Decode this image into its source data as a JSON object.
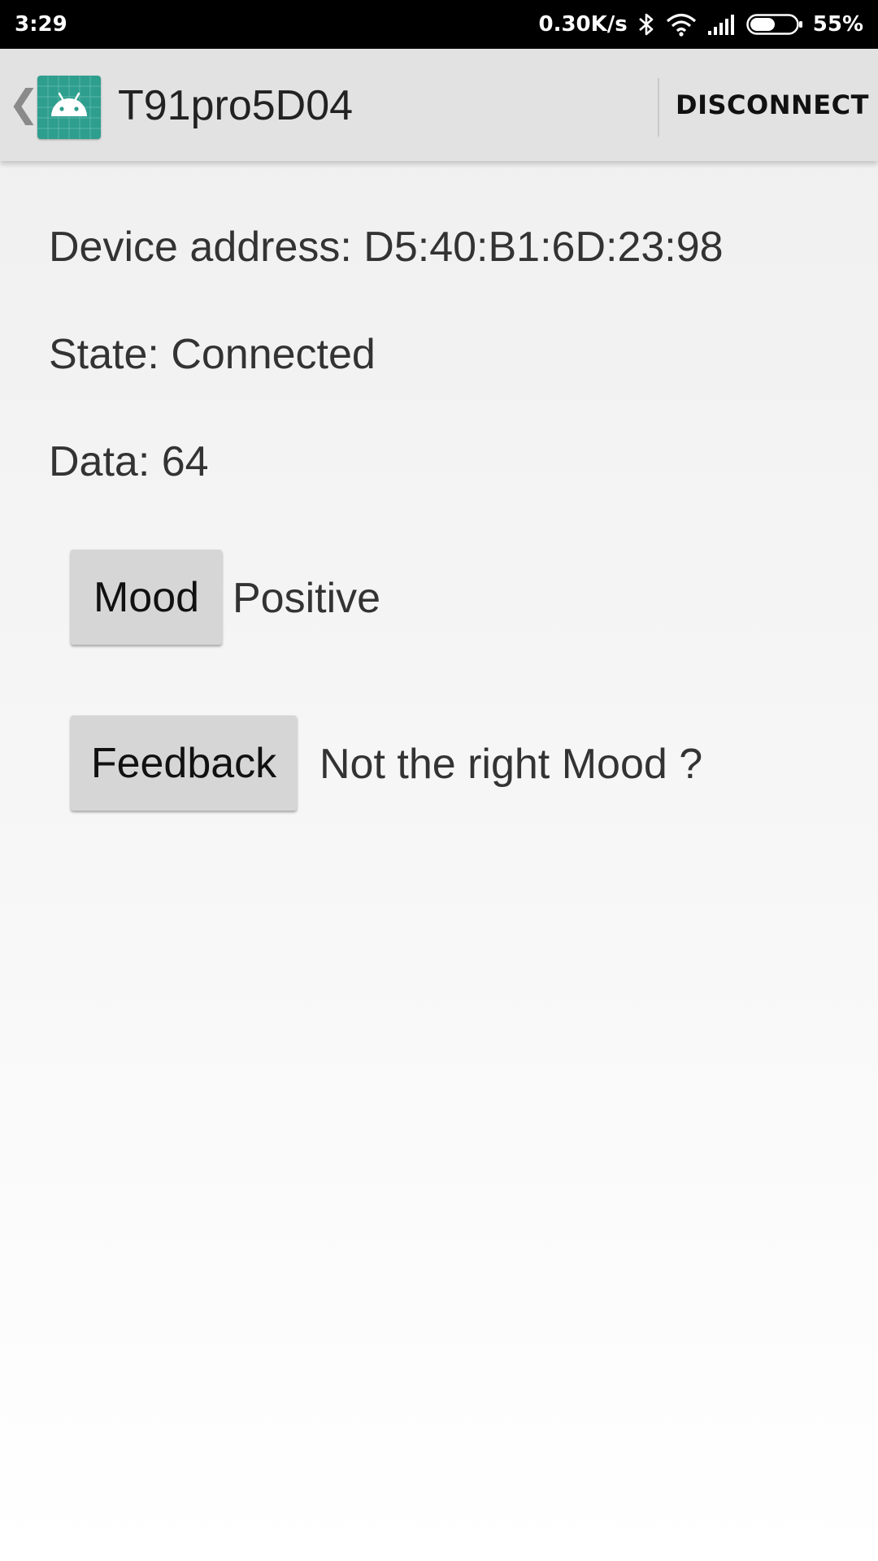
{
  "status_bar": {
    "time": "3:29",
    "network_speed": "0.30K/s",
    "battery_percent": "55%",
    "battery_level": 0.55,
    "icons": [
      "bluetooth-icon",
      "wifi-icon",
      "signal-icon",
      "battery-icon"
    ]
  },
  "app_bar": {
    "title": "T91pro5D04",
    "back_glyph": "❮",
    "action_label": "DISCONNECT"
  },
  "device": {
    "address_line": "Device address: D5:40:B1:6D:23:98",
    "state_line": "State: Connected",
    "data_line": "Data: 64"
  },
  "mood": {
    "button_label": "Mood",
    "value": "Positive"
  },
  "feedback": {
    "button_label": "Feedback",
    "prompt": "Not the right Mood ?"
  },
  "colors": {
    "app_icon": "#2e9e8e",
    "app_bar": "#e2e2e2",
    "button": "#d6d6d6"
  }
}
